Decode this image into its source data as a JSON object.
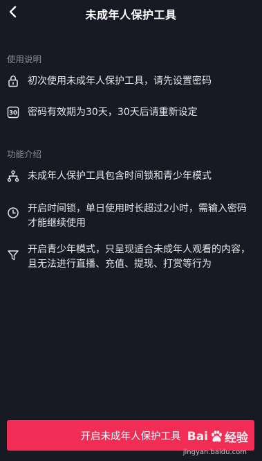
{
  "header": {
    "title": "未成年人保护工具",
    "back_icon": "chevron-left-icon"
  },
  "usage": {
    "section_title": "使用说明",
    "items": [
      {
        "icon": "lock-icon",
        "text": "初次使用未成年人保护工具，请先设置密码"
      },
      {
        "icon": "calendar-30-icon",
        "icon_text": "30",
        "text": "密码有效期为30天，30天后请重新设定"
      }
    ]
  },
  "features": {
    "section_title": "功能介绍",
    "items": [
      {
        "icon": "hierarchy-icon",
        "text": "未成年人保护工具包含时间锁和青少年模式"
      },
      {
        "icon": "clock-icon",
        "text": "开启时间锁，单日使用时长超过2小时，需输入密码才能继续使用"
      },
      {
        "icon": "filter-icon",
        "text": "开启青少年模式，只呈现适合未成年人观看的内容，且无法进行直播、充值、提现、打赏等行为"
      }
    ]
  },
  "footer": {
    "button_label": "开启未成年人保护工具"
  },
  "watermark": {
    "left": "Bai",
    "logo_icon": "baidu-paw-icon",
    "right": "经验",
    "sub": "jingyan.baidu.com"
  },
  "colors": {
    "background": "#181a23",
    "accent": "#f12d55",
    "muted": "#8c8d95"
  }
}
